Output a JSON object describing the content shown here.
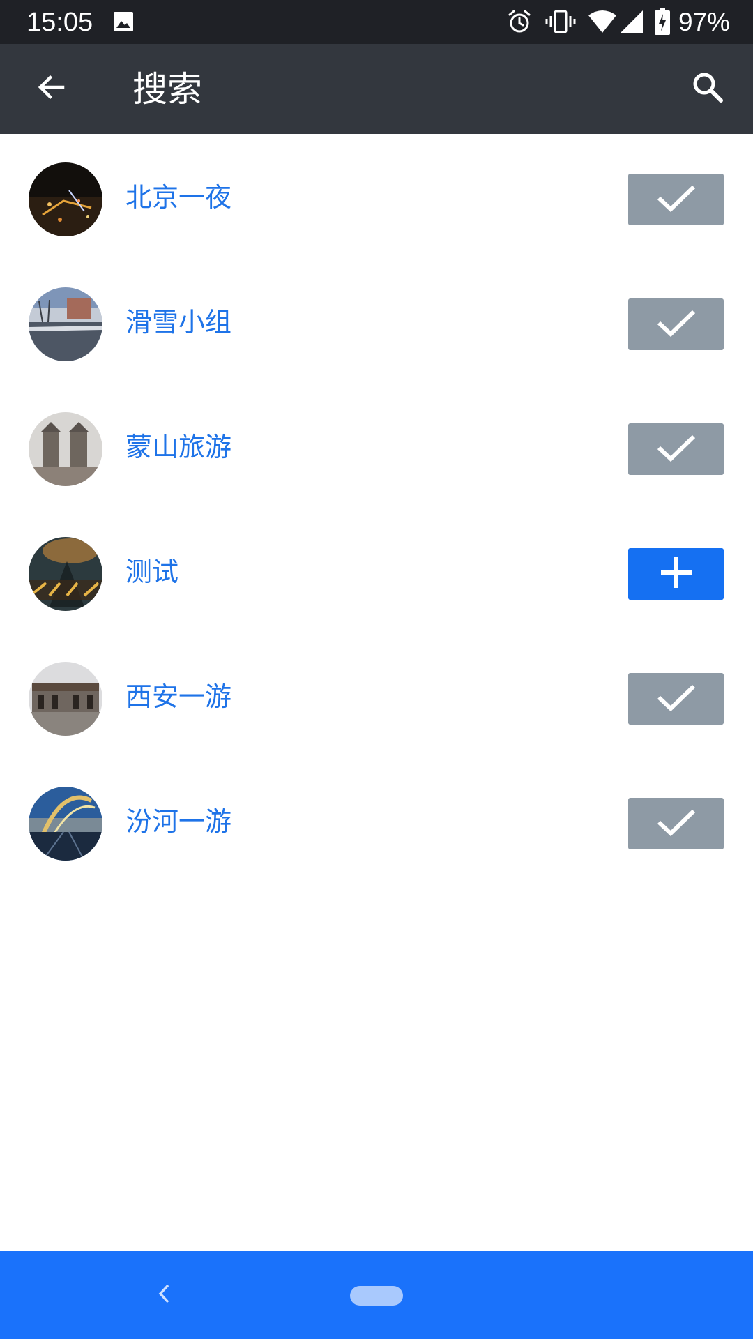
{
  "status_bar": {
    "time": "15:05",
    "battery": "97%",
    "icons": [
      "gallery-icon",
      "alarm-icon",
      "vibrate-icon",
      "wifi-icon",
      "signal-icon",
      "battery-charging-icon"
    ]
  },
  "app_bar": {
    "title": "搜索",
    "back_icon": "arrow-left-icon",
    "search_icon": "search-icon"
  },
  "groups": [
    {
      "name": "北京一夜",
      "status": "joined"
    },
    {
      "name": "滑雪小组",
      "status": "joined"
    },
    {
      "name": "蒙山旅游",
      "status": "joined"
    },
    {
      "name": "测试",
      "status": "add"
    },
    {
      "name": "西安一游",
      "status": "joined"
    },
    {
      "name": "汾河一游",
      "status": "joined"
    }
  ],
  "colors": {
    "status_bar_bg": "#1f2126",
    "app_bar_bg": "#33373e",
    "name_text": "#1e73e8",
    "joined_button": "#8e9aa5",
    "add_button": "#1570f2",
    "nav_bar_bg": "#1a72fb"
  }
}
